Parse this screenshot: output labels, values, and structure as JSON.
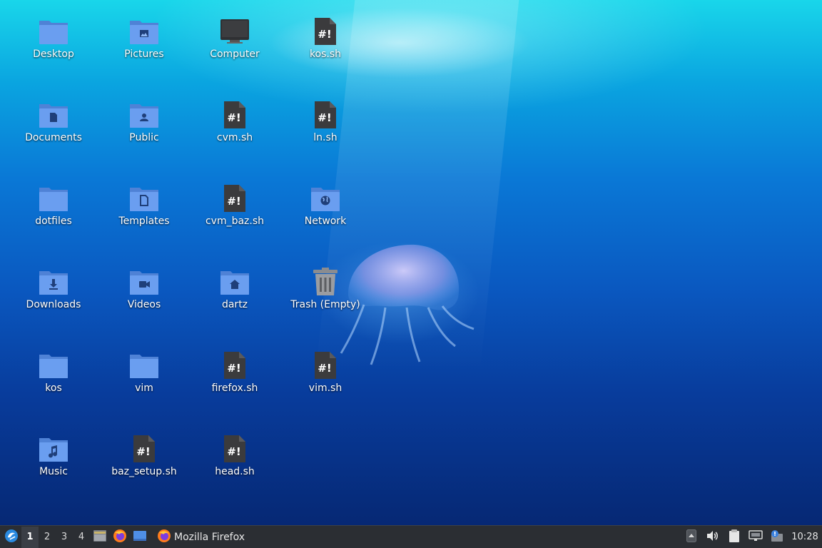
{
  "desktop": {
    "icons": [
      {
        "label": "Desktop",
        "icon": "folder-icon"
      },
      {
        "label": "Documents",
        "icon": "folder-documents-icon"
      },
      {
        "label": "dotfiles",
        "icon": "folder-icon"
      },
      {
        "label": "Downloads",
        "icon": "folder-downloads-icon"
      },
      {
        "label": "kos",
        "icon": "folder-icon"
      },
      {
        "label": "Music",
        "icon": "folder-music-icon"
      },
      {
        "label": "Pictures",
        "icon": "folder-pictures-icon"
      },
      {
        "label": "Public",
        "icon": "folder-public-icon"
      },
      {
        "label": "Templates",
        "icon": "folder-templates-icon"
      },
      {
        "label": "Videos",
        "icon": "folder-videos-icon"
      },
      {
        "label": "vim",
        "icon": "folder-icon"
      },
      {
        "label": "baz_setup.sh",
        "icon": "shell-script-icon"
      },
      {
        "label": "Computer",
        "icon": "computer-monitor-icon"
      },
      {
        "label": "cvm.sh",
        "icon": "shell-script-icon"
      },
      {
        "label": "cvm_baz.sh",
        "icon": "shell-script-icon"
      },
      {
        "label": "dartz",
        "icon": "folder-home-icon"
      },
      {
        "label": "firefox.sh",
        "icon": "shell-script-icon"
      },
      {
        "label": "head.sh",
        "icon": "shell-script-icon"
      },
      {
        "label": "kos.sh",
        "icon": "shell-script-icon"
      },
      {
        "label": "ln.sh",
        "icon": "shell-script-icon"
      },
      {
        "label": "Network",
        "icon": "folder-network-icon"
      },
      {
        "label": "Trash (Empty)",
        "icon": "trash-empty-icon"
      },
      {
        "label": "vim.sh",
        "icon": "shell-script-icon"
      }
    ]
  },
  "taskbar": {
    "menu_icon": "start-menu-icon",
    "workspaces": [
      "1",
      "2",
      "3",
      "4"
    ],
    "active_workspace": "1",
    "launchers": [
      "file-manager-icon",
      "firefox-icon",
      "show-desktop-icon"
    ],
    "task": {
      "label": "Mozilla Firefox",
      "icon": "firefox-icon"
    },
    "tray": [
      "tray-arrow-up-icon",
      "volume-icon",
      "clipboard-icon",
      "network-wired-icon",
      "update-notifier-icon"
    ],
    "clock": "10:28"
  },
  "colors": {
    "folder_blue": "#5b8fe0",
    "taskbar_bg": "#2b2e33",
    "script_dark": "#3a3a3c"
  }
}
